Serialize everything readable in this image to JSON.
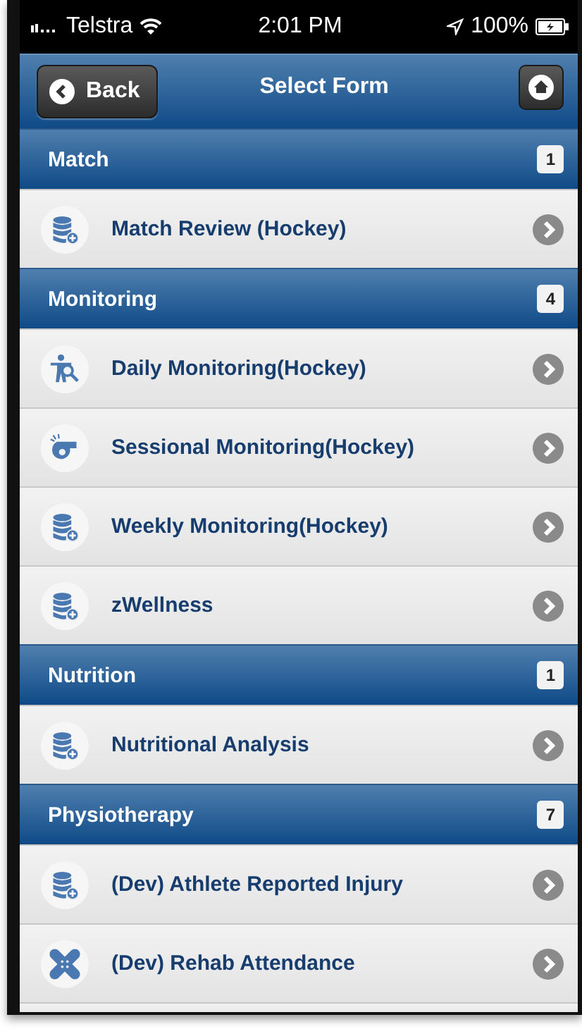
{
  "status_bar": {
    "carrier": "Telstra",
    "time": "2:01 PM",
    "battery": "100%"
  },
  "nav_bar": {
    "back": "Back",
    "title": "Select Form"
  },
  "sections": [
    {
      "title": "Match",
      "count": "1",
      "items": [
        {
          "label": "Match Review (Hockey)",
          "kind": "database"
        }
      ]
    },
    {
      "title": "Monitoring",
      "count": "4",
      "items": [
        {
          "label": "Daily Monitoring(Hockey)",
          "kind": "figure"
        },
        {
          "label": "Sessional Monitoring(Hockey)",
          "kind": "whistle"
        },
        {
          "label": "Weekly Monitoring(Hockey)",
          "kind": "database"
        },
        {
          "label": "zWellness",
          "kind": "database"
        }
      ]
    },
    {
      "title": "Nutrition",
      "count": "1",
      "items": [
        {
          "label": "Nutritional Analysis",
          "kind": "database"
        }
      ]
    },
    {
      "title": "Physiotherapy",
      "count": "7",
      "items": [
        {
          "label": "(Dev) Athlete Reported Injury",
          "kind": "database"
        },
        {
          "label": "(Dev) Rehab Attendance",
          "kind": "bandage"
        }
      ]
    }
  ]
}
